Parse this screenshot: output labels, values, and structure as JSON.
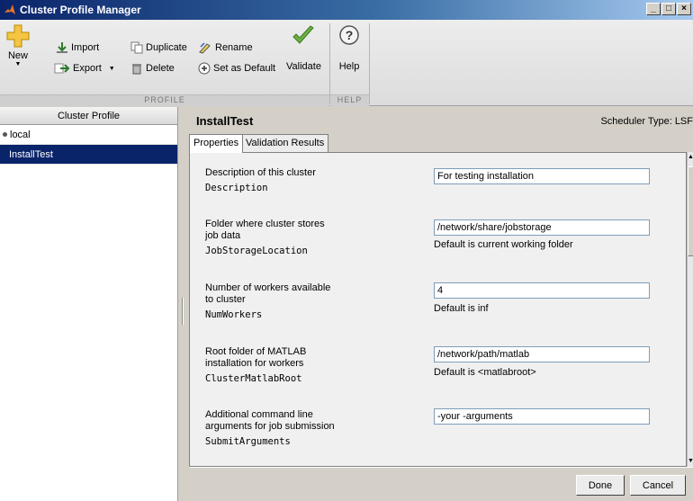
{
  "window": {
    "title": "Cluster Profile Manager"
  },
  "toolstrip": {
    "new_label": "New",
    "import_label": "Import",
    "export_label": "Export",
    "duplicate_label": "Duplicate",
    "delete_label": "Delete",
    "rename_label": "Rename",
    "set_default_label": "Set as Default",
    "validate_label": "Validate",
    "help_label": "Help",
    "profile_section": "PROFILE",
    "help_section": "HELP"
  },
  "profiles": {
    "header": "Cluster Profile",
    "items": [
      {
        "label": "local",
        "default": true
      },
      {
        "label": "InstallTest",
        "selected": true
      }
    ]
  },
  "detail": {
    "title": "InstallTest",
    "scheduler_type": "Scheduler Type: LSF",
    "tabs": [
      "Properties",
      "Validation Results"
    ],
    "properties": [
      {
        "desc": [
          "Description of this cluster"
        ],
        "name": "Description",
        "value": "For testing installation",
        "hint": ""
      },
      {
        "desc": [
          "Folder where cluster stores",
          "job data"
        ],
        "name": "JobStorageLocation",
        "value": "/network/share/jobstorage",
        "hint": "Default is current working folder"
      },
      {
        "desc": [
          "Number of workers available",
          "to cluster"
        ],
        "name": "NumWorkers",
        "value": "4",
        "hint": "Default is inf"
      },
      {
        "desc": [
          "Root folder of MATLAB",
          "installation for workers"
        ],
        "name": "ClusterMatlabRoot",
        "value": "/network/path/matlab",
        "hint": "Default is <matlabroot>"
      },
      {
        "desc": [
          "Additional command line",
          "arguments for job submission"
        ],
        "name": "SubmitArguments",
        "value": "-your -arguments",
        "hint": ""
      }
    ],
    "done_label": "Done",
    "cancel_label": "Cancel"
  }
}
